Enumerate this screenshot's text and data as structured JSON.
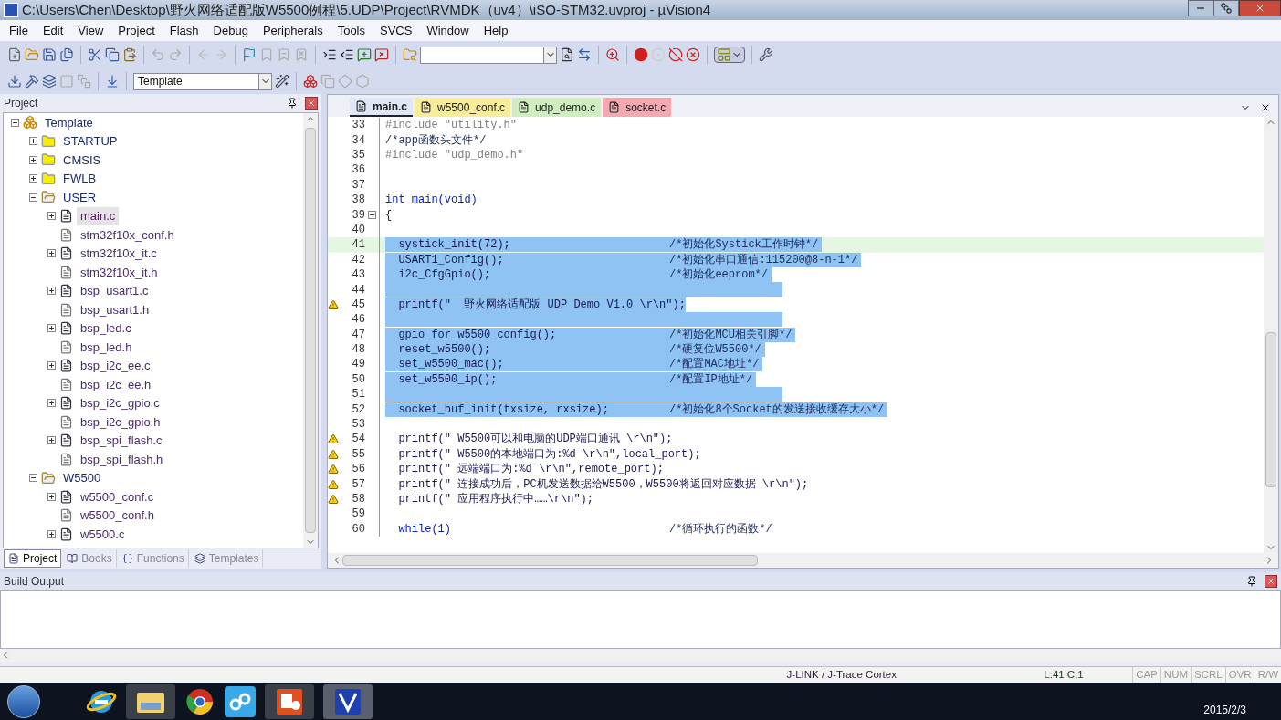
{
  "window": {
    "title": "C:\\Users\\Chen\\Desktop\\野火网络适配版W5500例程\\5.UDP\\Project\\RVMDK（uv4）\\iSO-STM32.uvproj - µVision4"
  },
  "menu": [
    "File",
    "Edit",
    "View",
    "Project",
    "Flash",
    "Debug",
    "Peripherals",
    "Tools",
    "SVCS",
    "Window",
    "Help"
  ],
  "toolbar": {
    "target_combo": {
      "value": "Template"
    }
  },
  "project_panel": {
    "title": "Project",
    "tree": [
      {
        "label": "Template",
        "kind": "root",
        "expanded": true,
        "selected": false,
        "children": [
          {
            "label": "STARTUP",
            "kind": "folder",
            "expanded": false,
            "selected": false
          },
          {
            "label": "CMSIS",
            "kind": "folder",
            "expanded": false,
            "selected": false
          },
          {
            "label": "FWLB",
            "kind": "folder",
            "expanded": false,
            "selected": false
          },
          {
            "label": "USER",
            "kind": "folder",
            "expanded": true,
            "selected": false,
            "children": [
              {
                "label": "main.c",
                "kind": "source",
                "expanded": false,
                "selected": true
              },
              {
                "label": "stm32f10x_conf.h",
                "kind": "header",
                "selected": false
              },
              {
                "label": "stm32f10x_it.c",
                "kind": "source",
                "expanded": false,
                "selected": false
              },
              {
                "label": "stm32f10x_it.h",
                "kind": "header",
                "selected": false
              },
              {
                "label": "bsp_usart1.c",
                "kind": "source",
                "expanded": false,
                "selected": false
              },
              {
                "label": "bsp_usart1.h",
                "kind": "header",
                "selected": false
              },
              {
                "label": "bsp_led.c",
                "kind": "source",
                "expanded": false,
                "selected": false
              },
              {
                "label": "bsp_led.h",
                "kind": "header",
                "selected": false
              },
              {
                "label": "bsp_i2c_ee.c",
                "kind": "source",
                "expanded": false,
                "selected": false
              },
              {
                "label": "bsp_i2c_ee.h",
                "kind": "header",
                "selected": false
              },
              {
                "label": "bsp_i2c_gpio.c",
                "kind": "source",
                "expanded": false,
                "selected": false
              },
              {
                "label": "bsp_i2c_gpio.h",
                "kind": "header",
                "selected": false
              },
              {
                "label": "bsp_spi_flash.c",
                "kind": "source",
                "expanded": false,
                "selected": false
              },
              {
                "label": "bsp_spi_flash.h",
                "kind": "header",
                "selected": false
              }
            ]
          },
          {
            "label": "W5500",
            "kind": "folder",
            "expanded": true,
            "selected": false,
            "children": [
              {
                "label": "w5500_conf.c",
                "kind": "source",
                "expanded": false,
                "selected": false
              },
              {
                "label": "w5500_conf.h",
                "kind": "header",
                "selected": false
              },
              {
                "label": "w5500.c",
                "kind": "source",
                "expanded": false,
                "selected": false
              }
            ]
          }
        ]
      }
    ],
    "tabs": [
      {
        "label": "Project",
        "selected": true
      },
      {
        "label": "Books",
        "selected": false
      },
      {
        "label": "Functions",
        "selected": false
      },
      {
        "label": "Templates",
        "selected": false
      }
    ]
  },
  "editor": {
    "tabs": [
      {
        "label": "main.c",
        "selected": true,
        "color": "#dfe6f5"
      },
      {
        "label": "w5500_conf.c",
        "selected": false,
        "color": "#f7ec9a"
      },
      {
        "label": "udp_demo.c",
        "selected": false,
        "color": "#cfeec0"
      },
      {
        "label": "socket.c",
        "selected": false,
        "color": "#f4a8b0"
      }
    ],
    "lines": [
      {
        "num": "33",
        "kind": "preprocessor",
        "code": "#include \"utility.h\"",
        "selected": false,
        "current": false,
        "warning": false
      },
      {
        "num": "34",
        "kind": "comment",
        "code": "/*app函数头文件*/",
        "selected": false,
        "current": false,
        "warning": false
      },
      {
        "num": "35",
        "kind": "preprocessor",
        "code": "#include \"udp_demo.h\"",
        "selected": false,
        "current": false,
        "warning": false
      },
      {
        "num": "36",
        "kind": "code",
        "selected": false,
        "current": false,
        "warning": false
      },
      {
        "num": "37",
        "kind": "code",
        "selected": false,
        "current": false,
        "warning": false
      },
      {
        "num": "38",
        "kind": "keyword",
        "code": "int main(void)",
        "selected": false,
        "current": false,
        "warning": false
      },
      {
        "num": "39",
        "kind": "code",
        "code": "{",
        "fold": true,
        "selected": false,
        "current": false,
        "warning": false
      },
      {
        "num": "40",
        "kind": "code",
        "selected": false,
        "current": false,
        "warning": false
      },
      {
        "num": "41",
        "kind": "code",
        "code": "  systick_init(72);",
        "comment": "/*初始化Systick工作时钟*/",
        "selected": true,
        "current": true,
        "warning": false
      },
      {
        "num": "42",
        "kind": "code",
        "code": "  USART1_Config();",
        "comment": "/*初始化串口通信:115200@8-n-1*/",
        "selected": true,
        "current": false,
        "warning": false
      },
      {
        "num": "43",
        "kind": "code",
        "code": "  i2c_CfgGpio();",
        "comment": "/*初始化eeprom*/",
        "selected": true,
        "current": false,
        "warning": false
      },
      {
        "num": "44",
        "kind": "code",
        "selected": true,
        "current": false,
        "warning": false
      },
      {
        "num": "45",
        "kind": "code",
        "code": "  printf(\"  野火网络适配版 UDP Demo V1.0 \\r\\n\");",
        "selected": true,
        "current": false,
        "warning": true
      },
      {
        "num": "46",
        "kind": "code",
        "selected": true,
        "current": false,
        "warning": false
      },
      {
        "num": "47",
        "kind": "code",
        "code": "  gpio_for_w5500_config();",
        "comment": "/*初始化MCU相关引脚*/",
        "selected": true,
        "current": false,
        "warning": false
      },
      {
        "num": "48",
        "kind": "code",
        "code": "  reset_w5500();",
        "comment": "/*硬复位W5500*/",
        "selected": true,
        "current": false,
        "warning": false
      },
      {
        "num": "49",
        "kind": "code",
        "code": "  set_w5500_mac();",
        "comment": "/*配置MAC地址*/",
        "selected": true,
        "current": false,
        "warning": false
      },
      {
        "num": "50",
        "kind": "code",
        "code": "  set_w5500_ip();",
        "comment": "/*配置IP地址*/",
        "selected": true,
        "current": false,
        "warning": false
      },
      {
        "num": "51",
        "kind": "code",
        "selected": true,
        "current": false,
        "warning": false
      },
      {
        "num": "52",
        "kind": "code",
        "code": "  socket_buf_init(txsize, rxsize);",
        "comment": "/*初始化8个Socket的发送接收缓存大小*/",
        "selected": true,
        "current": false,
        "warning": false
      },
      {
        "num": "53",
        "kind": "code",
        "selected": false,
        "current": false,
        "warning": false
      },
      {
        "num": "54",
        "kind": "code",
        "code": "  printf(\" W5500可以和电脑的UDP端口通讯 \\r\\n\");",
        "selected": false,
        "current": false,
        "warning": true
      },
      {
        "num": "55",
        "kind": "code",
        "code": "  printf(\" W5500的本地端口为:%d \\r\\n\",local_port);",
        "selected": false,
        "current": false,
        "warning": true
      },
      {
        "num": "56",
        "kind": "code",
        "code": "  printf(\" 远端端口为:%d \\r\\n\",remote_port);",
        "selected": false,
        "current": false,
        "warning": true
      },
      {
        "num": "57",
        "kind": "code",
        "code": "  printf(\" 连接成功后，PC机发送数据给W5500，W5500将返回对应数据 \\r\\n\");",
        "selected": false,
        "current": false,
        "warning": true
      },
      {
        "num": "58",
        "kind": "code",
        "code": "  printf(\" 应用程序执行中……\\r\\n\");",
        "selected": false,
        "current": false,
        "warning": true
      },
      {
        "num": "59",
        "kind": "code",
        "selected": false,
        "current": false,
        "warning": false
      },
      {
        "num": "60",
        "kind": "keyword",
        "code": "  while(1)",
        "comment": "/*循环执行的函数*/",
        "selected": false,
        "current": false,
        "warning": false
      }
    ]
  },
  "build_output": {
    "title": "Build Output"
  },
  "status_bar": {
    "debugger": "J-LINK / J-Trace Cortex",
    "position": "L:41 C:1",
    "indicators": [
      "CAP",
      "NUM",
      "SCRL",
      "OVR",
      "R/W"
    ]
  },
  "taskbar": {
    "date": "2015/2/3"
  }
}
